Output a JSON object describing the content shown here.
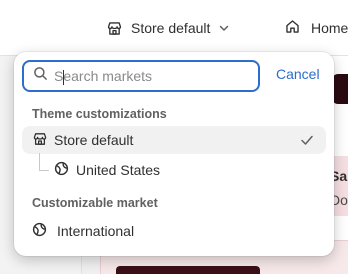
{
  "topbar": {
    "store_switcher_label": "Store default",
    "home_label": "Home"
  },
  "background": {
    "right_text_1": "Sa",
    "right_text_2": "Do"
  },
  "market_selector": {
    "search": {
      "placeholder": "Search markets",
      "value": ""
    },
    "cancel_label": "Cancel",
    "sections": [
      {
        "heading": "Theme customizations",
        "items": [
          {
            "label": "Store default",
            "icon": "store-icon",
            "selected": true
          },
          {
            "label": "United States",
            "icon": "globe-icon",
            "selected": false
          }
        ]
      },
      {
        "heading": "Customizable market",
        "items": [
          {
            "label": "International",
            "icon": "globe-icon",
            "selected": false
          }
        ]
      }
    ]
  },
  "colors": {
    "accent": "#2c6ecb",
    "selected_row": "#f1f1f1",
    "heading_text": "#616161"
  }
}
